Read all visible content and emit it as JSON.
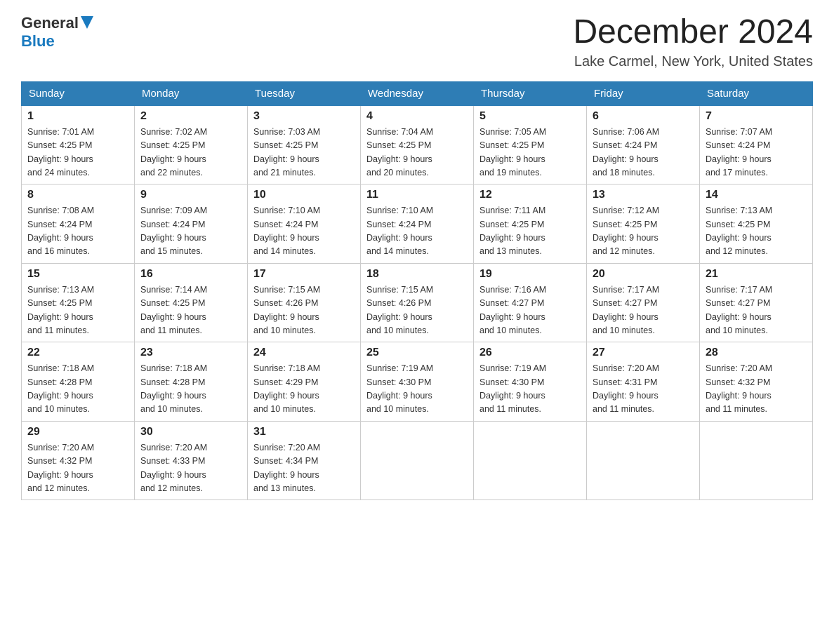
{
  "header": {
    "logo": {
      "general": "General",
      "blue": "Blue"
    },
    "title": "December 2024",
    "location": "Lake Carmel, New York, United States"
  },
  "weekdays": [
    "Sunday",
    "Monday",
    "Tuesday",
    "Wednesday",
    "Thursday",
    "Friday",
    "Saturday"
  ],
  "weeks": [
    [
      {
        "day": "1",
        "sunrise": "7:01 AM",
        "sunset": "4:25 PM",
        "daylight": "9 hours and 24 minutes."
      },
      {
        "day": "2",
        "sunrise": "7:02 AM",
        "sunset": "4:25 PM",
        "daylight": "9 hours and 22 minutes."
      },
      {
        "day": "3",
        "sunrise": "7:03 AM",
        "sunset": "4:25 PM",
        "daylight": "9 hours and 21 minutes."
      },
      {
        "day": "4",
        "sunrise": "7:04 AM",
        "sunset": "4:25 PM",
        "daylight": "9 hours and 20 minutes."
      },
      {
        "day": "5",
        "sunrise": "7:05 AM",
        "sunset": "4:25 PM",
        "daylight": "9 hours and 19 minutes."
      },
      {
        "day": "6",
        "sunrise": "7:06 AM",
        "sunset": "4:24 PM",
        "daylight": "9 hours and 18 minutes."
      },
      {
        "day": "7",
        "sunrise": "7:07 AM",
        "sunset": "4:24 PM",
        "daylight": "9 hours and 17 minutes."
      }
    ],
    [
      {
        "day": "8",
        "sunrise": "7:08 AM",
        "sunset": "4:24 PM",
        "daylight": "9 hours and 16 minutes."
      },
      {
        "day": "9",
        "sunrise": "7:09 AM",
        "sunset": "4:24 PM",
        "daylight": "9 hours and 15 minutes."
      },
      {
        "day": "10",
        "sunrise": "7:10 AM",
        "sunset": "4:24 PM",
        "daylight": "9 hours and 14 minutes."
      },
      {
        "day": "11",
        "sunrise": "7:10 AM",
        "sunset": "4:24 PM",
        "daylight": "9 hours and 14 minutes."
      },
      {
        "day": "12",
        "sunrise": "7:11 AM",
        "sunset": "4:25 PM",
        "daylight": "9 hours and 13 minutes."
      },
      {
        "day": "13",
        "sunrise": "7:12 AM",
        "sunset": "4:25 PM",
        "daylight": "9 hours and 12 minutes."
      },
      {
        "day": "14",
        "sunrise": "7:13 AM",
        "sunset": "4:25 PM",
        "daylight": "9 hours and 12 minutes."
      }
    ],
    [
      {
        "day": "15",
        "sunrise": "7:13 AM",
        "sunset": "4:25 PM",
        "daylight": "9 hours and 11 minutes."
      },
      {
        "day": "16",
        "sunrise": "7:14 AM",
        "sunset": "4:25 PM",
        "daylight": "9 hours and 11 minutes."
      },
      {
        "day": "17",
        "sunrise": "7:15 AM",
        "sunset": "4:26 PM",
        "daylight": "9 hours and 10 minutes."
      },
      {
        "day": "18",
        "sunrise": "7:15 AM",
        "sunset": "4:26 PM",
        "daylight": "9 hours and 10 minutes."
      },
      {
        "day": "19",
        "sunrise": "7:16 AM",
        "sunset": "4:27 PM",
        "daylight": "9 hours and 10 minutes."
      },
      {
        "day": "20",
        "sunrise": "7:17 AM",
        "sunset": "4:27 PM",
        "daylight": "9 hours and 10 minutes."
      },
      {
        "day": "21",
        "sunrise": "7:17 AM",
        "sunset": "4:27 PM",
        "daylight": "9 hours and 10 minutes."
      }
    ],
    [
      {
        "day": "22",
        "sunrise": "7:18 AM",
        "sunset": "4:28 PM",
        "daylight": "9 hours and 10 minutes."
      },
      {
        "day": "23",
        "sunrise": "7:18 AM",
        "sunset": "4:28 PM",
        "daylight": "9 hours and 10 minutes."
      },
      {
        "day": "24",
        "sunrise": "7:18 AM",
        "sunset": "4:29 PM",
        "daylight": "9 hours and 10 minutes."
      },
      {
        "day": "25",
        "sunrise": "7:19 AM",
        "sunset": "4:30 PM",
        "daylight": "9 hours and 10 minutes."
      },
      {
        "day": "26",
        "sunrise": "7:19 AM",
        "sunset": "4:30 PM",
        "daylight": "9 hours and 11 minutes."
      },
      {
        "day": "27",
        "sunrise": "7:20 AM",
        "sunset": "4:31 PM",
        "daylight": "9 hours and 11 minutes."
      },
      {
        "day": "28",
        "sunrise": "7:20 AM",
        "sunset": "4:32 PM",
        "daylight": "9 hours and 11 minutes."
      }
    ],
    [
      {
        "day": "29",
        "sunrise": "7:20 AM",
        "sunset": "4:32 PM",
        "daylight": "9 hours and 12 minutes."
      },
      {
        "day": "30",
        "sunrise": "7:20 AM",
        "sunset": "4:33 PM",
        "daylight": "9 hours and 12 minutes."
      },
      {
        "day": "31",
        "sunrise": "7:20 AM",
        "sunset": "4:34 PM",
        "daylight": "9 hours and 13 minutes."
      },
      null,
      null,
      null,
      null
    ]
  ],
  "labels": {
    "sunrise": "Sunrise:",
    "sunset": "Sunset:",
    "daylight": "Daylight:"
  }
}
